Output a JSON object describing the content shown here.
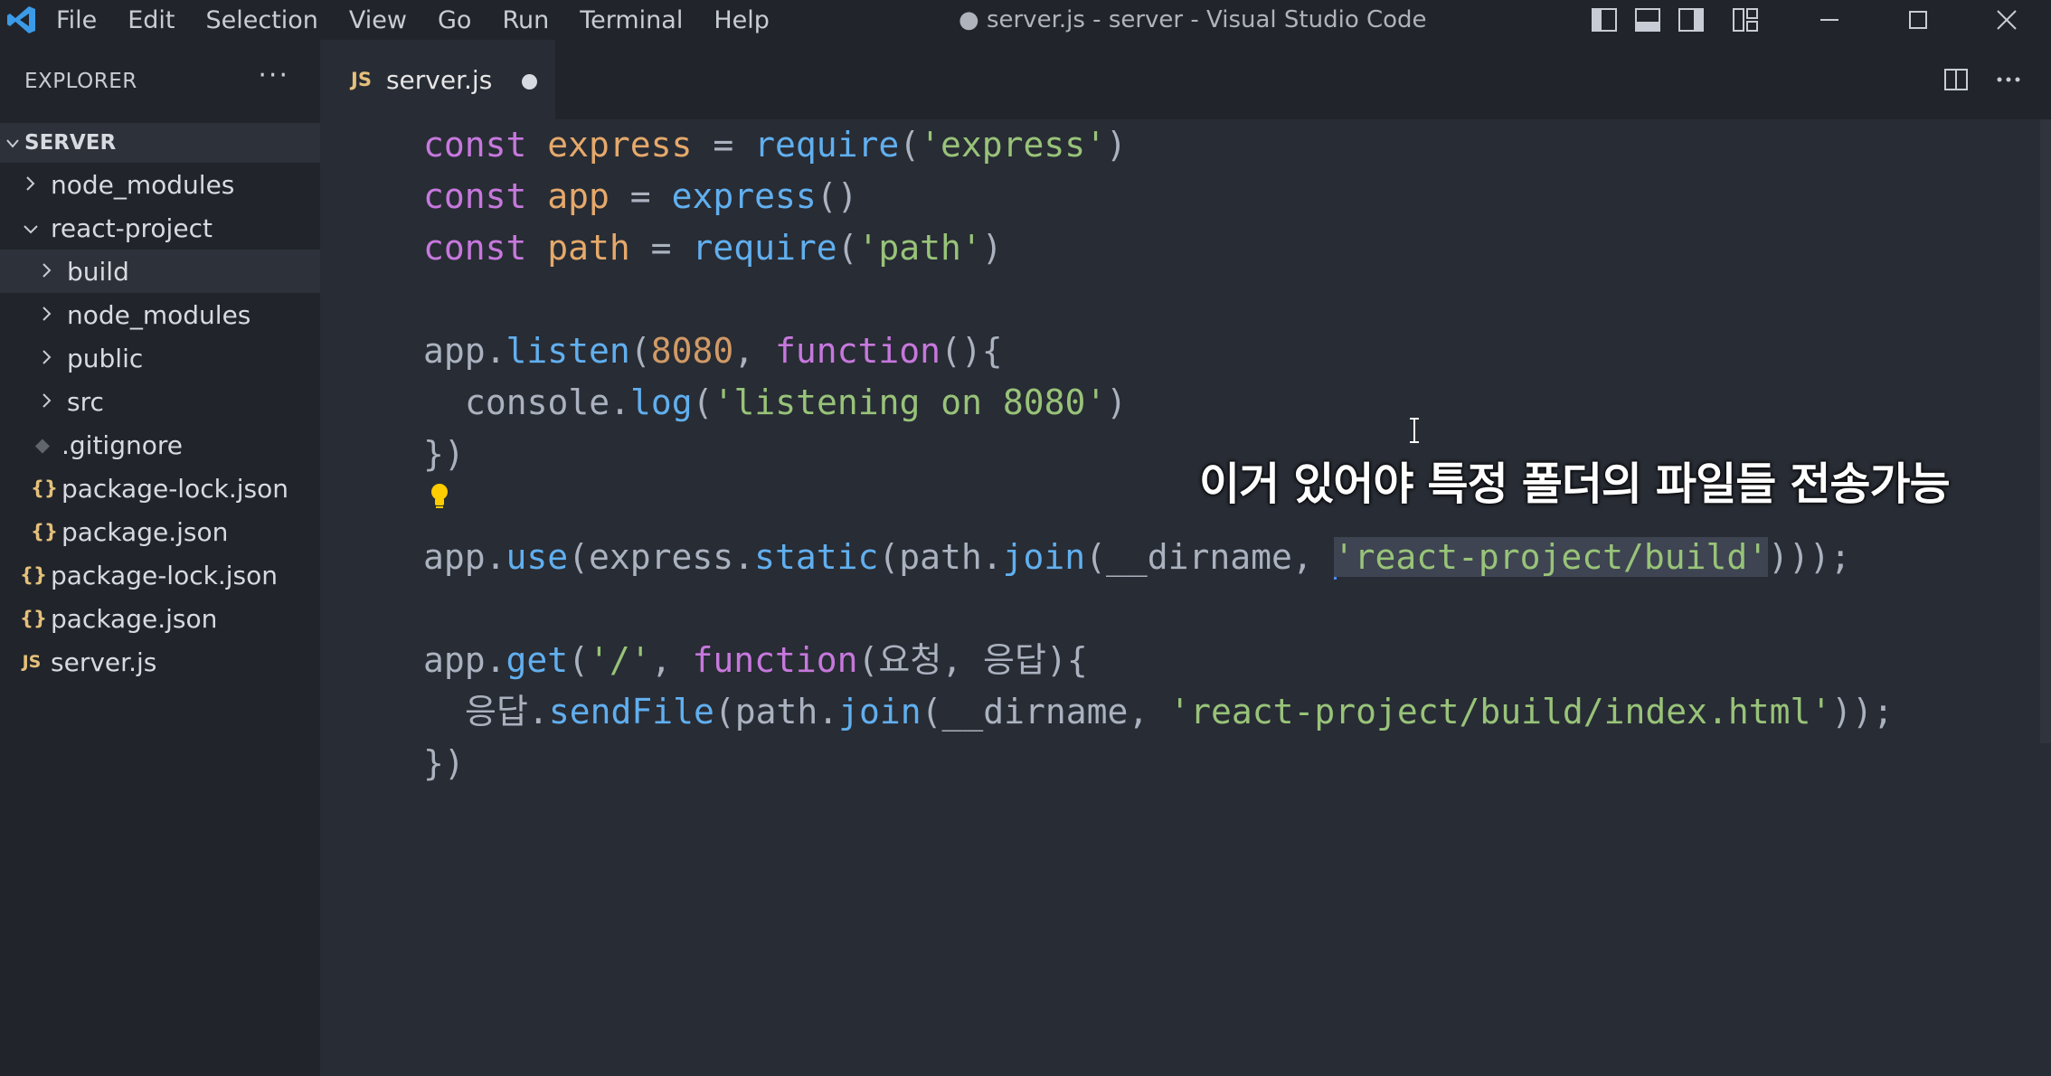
{
  "titlebar": {
    "menu": [
      "File",
      "Edit",
      "Selection",
      "View",
      "Go",
      "Run",
      "Terminal",
      "Help"
    ],
    "window_title": "● server.js - server - Visual Studio Code"
  },
  "sidebar": {
    "header": "EXPLORER",
    "more": "···",
    "section": "SERVER",
    "items": [
      {
        "label": "node_modules",
        "type": "folder",
        "expanded": false,
        "depth": 0
      },
      {
        "label": "react-project",
        "type": "folder",
        "expanded": true,
        "depth": 0
      },
      {
        "label": "build",
        "type": "folder",
        "expanded": false,
        "depth": 1,
        "selected": true
      },
      {
        "label": "node_modules",
        "type": "folder",
        "expanded": false,
        "depth": 1
      },
      {
        "label": "public",
        "type": "folder",
        "expanded": false,
        "depth": 1
      },
      {
        "label": "src",
        "type": "folder",
        "expanded": false,
        "depth": 1
      },
      {
        "label": ".gitignore",
        "type": "git",
        "depth": 1
      },
      {
        "label": "package-lock.json",
        "type": "json",
        "depth": 1
      },
      {
        "label": "package.json",
        "type": "json",
        "depth": 1
      },
      {
        "label": "package-lock.json",
        "type": "json",
        "depth": 0
      },
      {
        "label": "package.json",
        "type": "json",
        "depth": 0
      },
      {
        "label": "server.js",
        "type": "js",
        "depth": 0
      }
    ]
  },
  "tab": {
    "badge": "JS",
    "label": "server.js",
    "modified": true
  },
  "editor": {
    "lines": [
      {
        "tokens": [
          [
            "kw",
            "const "
          ],
          [
            "var",
            "express"
          ],
          [
            "pl",
            " = "
          ],
          [
            "fn",
            "require"
          ],
          [
            "pl",
            "("
          ],
          [
            "str",
            "'express'"
          ],
          [
            "pl",
            ")"
          ]
        ]
      },
      {
        "tokens": [
          [
            "kw",
            "const "
          ],
          [
            "var",
            "app"
          ],
          [
            "pl",
            " = "
          ],
          [
            "fn",
            "express"
          ],
          [
            "pl",
            "()"
          ]
        ]
      },
      {
        "tokens": [
          [
            "kw",
            "const "
          ],
          [
            "var",
            "path"
          ],
          [
            "pl",
            " = "
          ],
          [
            "fn",
            "require"
          ],
          [
            "pl",
            "("
          ],
          [
            "str",
            "'path'"
          ],
          [
            "pl",
            ")"
          ]
        ]
      },
      {
        "tokens": []
      },
      {
        "tokens": [
          [
            "pl",
            "app."
          ],
          [
            "fn",
            "listen"
          ],
          [
            "pl",
            "("
          ],
          [
            "num",
            "8080"
          ],
          [
            "pl",
            ", "
          ],
          [
            "kw",
            "function"
          ],
          [
            "pl",
            "(){"
          ]
        ]
      },
      {
        "indent": 1,
        "tokens": [
          [
            "pl",
            "console."
          ],
          [
            "fn",
            "log"
          ],
          [
            "pl",
            "("
          ],
          [
            "str",
            "'listening on 8080'"
          ],
          [
            "pl",
            ")"
          ]
        ]
      },
      {
        "tokens": [
          [
            "pl",
            "})"
          ]
        ]
      },
      {
        "tokens": []
      },
      {
        "tokens": [
          [
            "pl",
            "app."
          ],
          [
            "fn",
            "use"
          ],
          [
            "pl",
            "(express."
          ],
          [
            "fn",
            "static"
          ],
          [
            "pl",
            "(path."
          ],
          [
            "fn",
            "join"
          ],
          [
            "pl",
            "(__dirname, "
          ],
          [
            "cursor",
            ""
          ],
          [
            "str hl",
            "'react-project/build'"
          ],
          [
            "pl",
            ")));"
          ]
        ]
      },
      {
        "tokens": []
      },
      {
        "tokens": [
          [
            "pl",
            "app."
          ],
          [
            "fn",
            "get"
          ],
          [
            "pl",
            "("
          ],
          [
            "str",
            "'/'"
          ],
          [
            "pl",
            ", "
          ],
          [
            "kw",
            "function"
          ],
          [
            "pl",
            "(요청, 응답){"
          ]
        ]
      },
      {
        "indent": 1,
        "tokens": [
          [
            "pl",
            "응답."
          ],
          [
            "fn",
            "sendFile"
          ],
          [
            "pl",
            "(path."
          ],
          [
            "fn",
            "join"
          ],
          [
            "pl",
            "(__dirname, "
          ],
          [
            "str",
            "'react-project/build/index.html'"
          ],
          [
            "pl",
            "));"
          ]
        ]
      },
      {
        "tokens": [
          [
            "pl",
            "})"
          ]
        ]
      }
    ]
  },
  "caption": "이거 있어야 특정 폴더의 파일들 전송가능",
  "colors": {
    "keyword": "#c678dd",
    "function": "#61afef",
    "string": "#98c379",
    "number": "#d19a66",
    "variable": "#e5a96b",
    "bg": "#282c34",
    "sidebar_bg": "#21252b"
  }
}
